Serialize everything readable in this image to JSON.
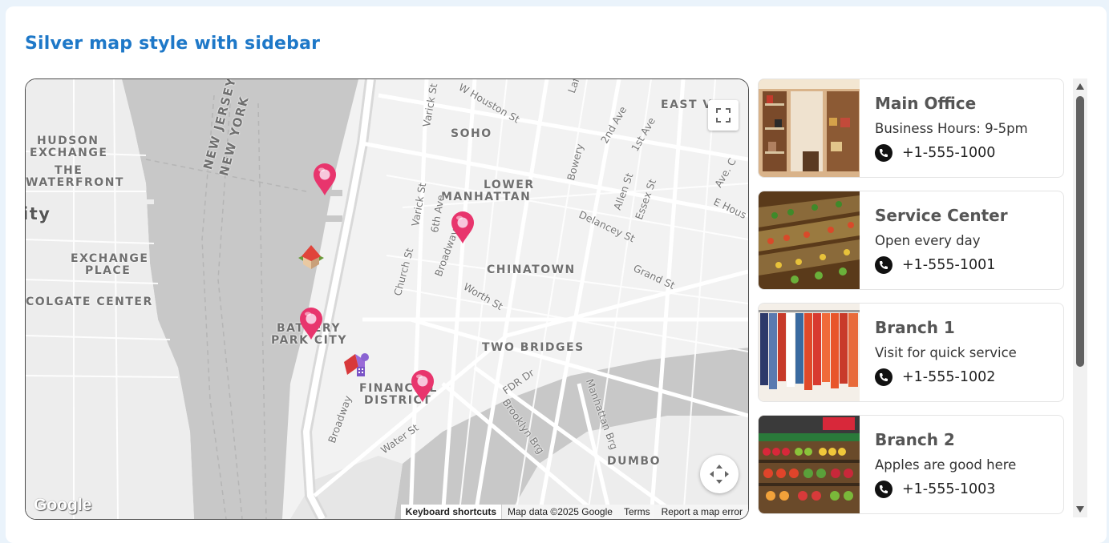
{
  "page": {
    "title": "Silver map style with sidebar"
  },
  "map": {
    "labels": {
      "hudson_exchange_1": "HUDSON",
      "hudson_exchange_2": "EXCHANGE",
      "waterfront_1": "THE",
      "waterfront_2": "WATERFRONT",
      "city_fragment": "ity",
      "exchange_place_1": "EXCHANGE",
      "exchange_place_2": "PLACE",
      "colgate": "COLGATE CENTER",
      "new_jersey": "NEW JERSEY",
      "new_york": "NEW YORK",
      "soho": "SOHO",
      "lower_manhattan_1": "LOWER",
      "lower_manhattan_2": "MANHATTAN",
      "chinatown": "CHINATOWN",
      "two_bridges": "TWO BRIDGES",
      "battery_park_1": "BATTERY",
      "battery_park_2": "PARK CITY",
      "financial_1": "FINANCIAL",
      "financial_2": "DISTRICT",
      "dumbo": "DUMBO",
      "east_village": "EAST V",
      "w_houston": "W Houston St",
      "varick_st_1": "Varick St",
      "varick_st_2": "Varick St",
      "sixth_ave": "6th Ave",
      "church_st": "Church St",
      "broadway_1": "Broadway",
      "broadway_2": "Broadway",
      "worth_st": "Worth St",
      "bowery": "Bowery",
      "second_ave": "2nd Ave",
      "first_ave": "1st Ave",
      "allen_st": "Allen St",
      "essex_st": "Essex St",
      "delancey_st": "Delancey St",
      "grand_st": "Grand St",
      "ave_c": "Ave. C",
      "e_houston": "E Hous",
      "lafayette": "Laf",
      "fdr_dr": "FDR Dr",
      "brooklyn_brg": "Brooklyn Brg",
      "manhattan_brg": "Manhattan Brg",
      "water_st": "Water St"
    },
    "google_logo": "Google",
    "attribution": {
      "keyboard": "Keyboard shortcuts",
      "data": "Map data ©2025 Google",
      "terms": "Terms",
      "report": "Report a map error"
    },
    "marker_color": "#e8356d"
  },
  "locations": [
    {
      "name": "Main Office",
      "description": "Business Hours: 9-5pm",
      "phone": "+1-555-1000",
      "thumb_icon": "boutique-photo"
    },
    {
      "name": "Service Center",
      "description": "Open every day",
      "phone": "+1-555-1001",
      "thumb_icon": "grocery-aisle-photo"
    },
    {
      "name": "Branch 1",
      "description": "Visit for quick service",
      "phone": "+1-555-1002",
      "thumb_icon": "clothing-rack-photo"
    },
    {
      "name": "Branch 2",
      "description": "Apples are good here",
      "phone": "+1-555-1003",
      "thumb_icon": "produce-market-photo"
    }
  ],
  "colors": {
    "title": "#1e78c8",
    "water": "#c9c9c9",
    "land": "#f0f0f0",
    "road": "#ffffff"
  }
}
